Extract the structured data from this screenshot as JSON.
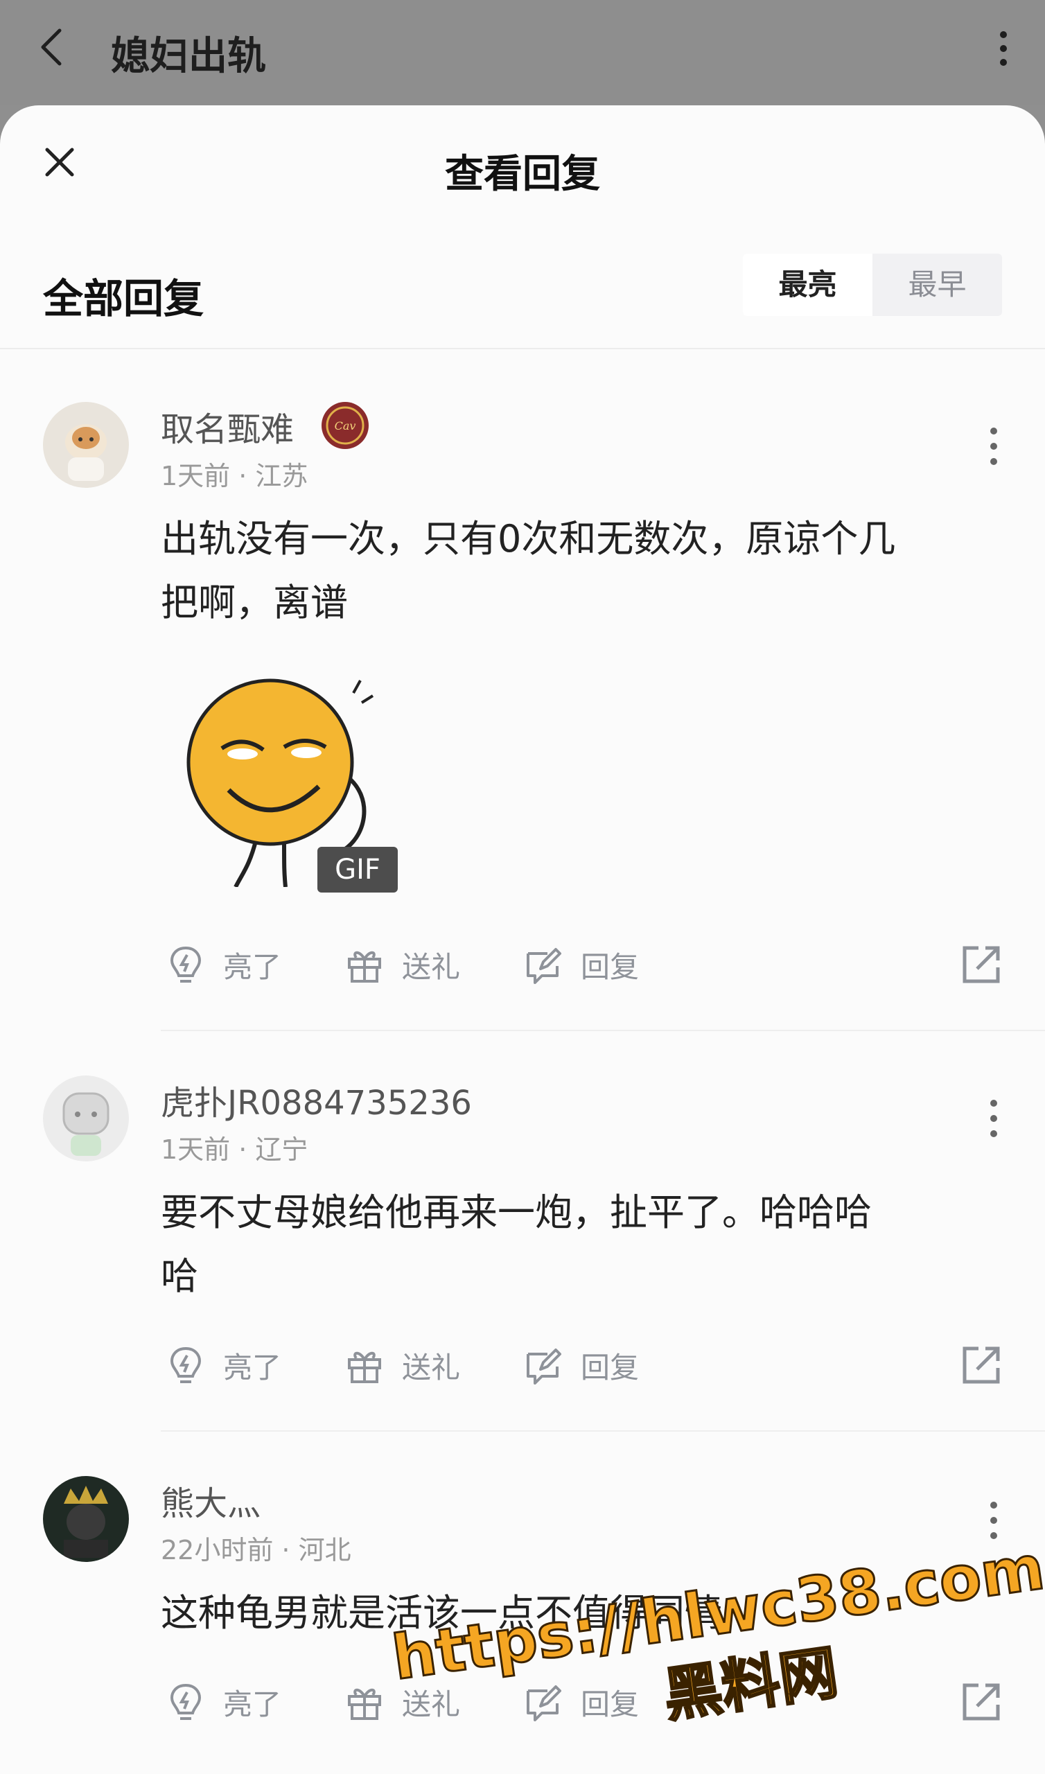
{
  "topbar": {
    "title": "媳妇出轨"
  },
  "sheet": {
    "title": "查看回复",
    "section_title": "全部回复",
    "sort": {
      "active": "最亮",
      "inactive": "最早"
    }
  },
  "actions": {
    "like": "亮了",
    "gift": "送礼",
    "reply": "回复"
  },
  "comments": [
    {
      "username": "取名甄难",
      "meta": "1天前 · 江苏",
      "text_line1": "出轨没有一次，只有0次和无数次，原谅个几",
      "text_line2": "把啊，离谱",
      "gif_label": "GIF"
    },
    {
      "username": "虎扑JR0884735236",
      "meta": "1天前 · 辽宁",
      "text_line1": "要不丈母娘给他再来一炮，扯平了。哈哈哈",
      "text_line2": "哈"
    },
    {
      "username": "熊大灬",
      "meta": "22小时前 · 河北",
      "text_line1": "这种龟男就是活该一点不值得同情"
    }
  ],
  "watermark": {
    "url": "https://hlwc38.com",
    "name": "黑料网"
  },
  "icons": [
    "back-arrow-icon",
    "more-vertical-icon",
    "close-icon",
    "bulb-icon",
    "gift-icon",
    "edit-reply-icon",
    "share-icon"
  ]
}
